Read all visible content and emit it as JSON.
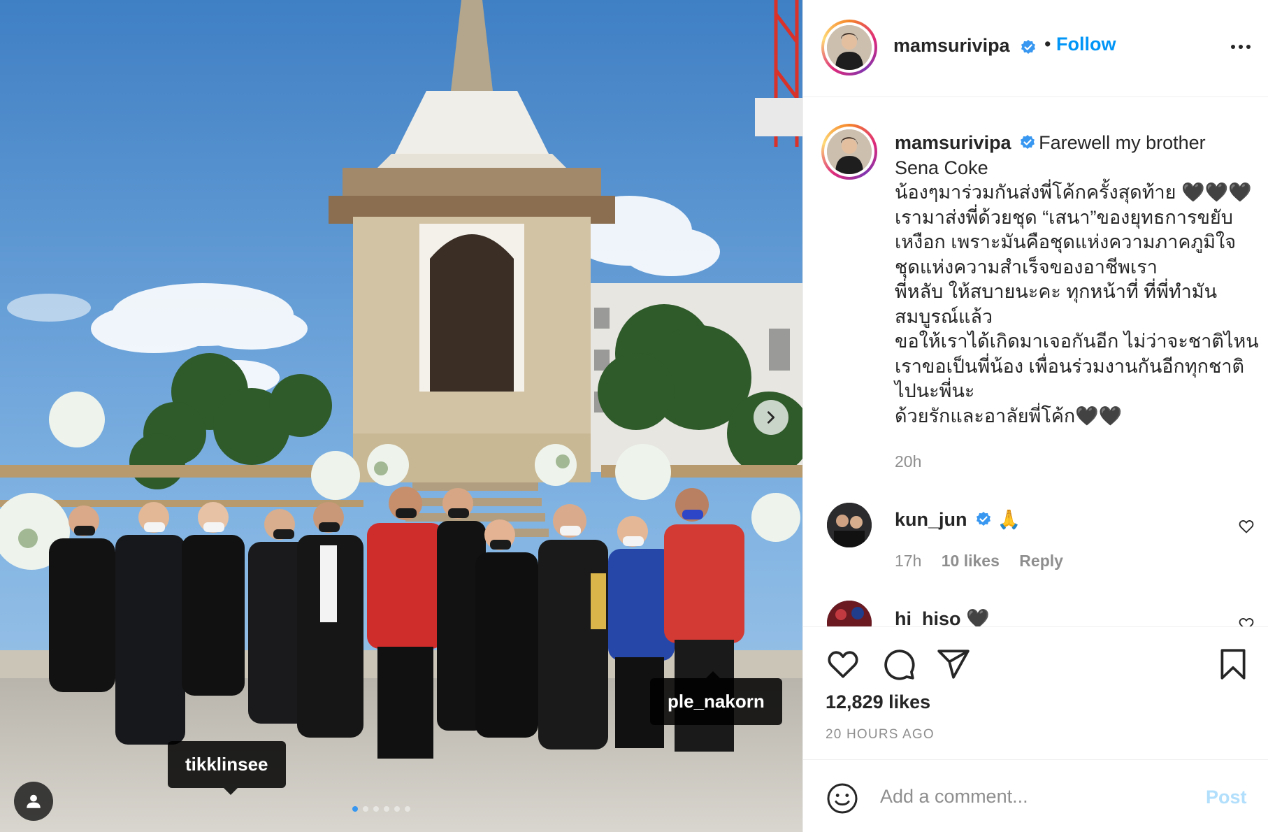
{
  "post": {
    "author": {
      "username": "mamsurivipa",
      "verified": true,
      "follow_label": "Follow",
      "separator": "•"
    },
    "photo": {
      "tags": [
        {
          "username": "tikklinsee"
        },
        {
          "username": "ple_nakorn"
        }
      ],
      "carousel_total": 6,
      "carousel_active": 0
    },
    "caption": {
      "username": "mamsurivipa",
      "lines": [
        "Farewell my brother",
        "Sena Coke",
        "น้องๆมาร่วมกันส่งพี่โค้กครั้งสุดท้าย 🖤🖤🖤",
        "เรามาส่งพี่ด้วยชุด “เสนา”ของยุทธการขยับ",
        "เหงือก เพราะมันคือชุดแห่งความภาคภูมิใจ",
        "ชุดแห่งความสำเร็จของอาชีพเรา",
        "พี่หลับ ให้สบายนะคะ ทุกหน้าที่ ที่พี่ทำมัน",
        "สมบูรณ์แล้ว",
        "ขอให้เราได้เกิดมาเจอกันอีก ไม่ว่าจะชาติไหน",
        "เราขอเป็นพี่น้อง เพื่อนร่วมงานกันอีกทุกชาติ",
        "ไปนะพี่นะ",
        "ด้วยรักและอาลัยพี่โค้ก🖤🖤"
      ],
      "time": "20h"
    },
    "comments": [
      {
        "username": "kun_jun",
        "verified": true,
        "text": "🙏",
        "time": "17h",
        "likes": "10 likes",
        "reply": "Reply"
      },
      {
        "username": "hi_hiso",
        "verified": false,
        "text": "🖤"
      }
    ],
    "likes": "12,829 likes",
    "age": "20 HOURS AGO",
    "comment_box": {
      "placeholder": "Add a comment...",
      "post_label": "Post"
    }
  },
  "colors": {
    "accent": "#0095f6",
    "verified": "#3897f0",
    "muted": "#8e8e8e",
    "post_disabled": "#b2dffc"
  },
  "icons": [
    "next-arrow-icon",
    "user-tags-icon",
    "more-options-icon",
    "verified-badge-icon",
    "heart-icon",
    "comment-icon",
    "share-icon",
    "bookmark-icon",
    "emoji-icon"
  ]
}
